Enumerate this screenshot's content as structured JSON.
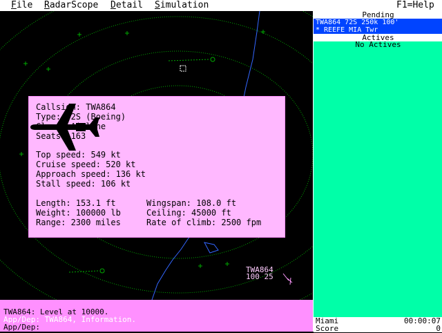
{
  "menu": {
    "file": {
      "hotkey": "F",
      "rest": "ile"
    },
    "radarscope": {
      "hotkey": "R",
      "rest": "adarScope"
    },
    "detail": {
      "hotkey": "D",
      "rest": "etail"
    },
    "simulation": {
      "hotkey": "S",
      "rest": "imulation"
    },
    "help": "F1=Help"
  },
  "panel": {
    "pending_title": "Pending",
    "pending_line1": "TWA864 72S 250k 100'",
    "pending_line2": "* REEFE MIA Twr",
    "actives_title": "Actives",
    "no_actives": "No Actives",
    "airport": "Miami",
    "clock": "00:00:07",
    "score_label": "Score",
    "score_value": "0"
  },
  "aircraft_info": {
    "callsign": "Callsign: TWA864",
    "type": "Type: 72S (Boeing)",
    "class": "Class: Airline",
    "seats": "Seats: 163",
    "top_speed": "Top speed: 549 kt",
    "cruise_speed": "Cruise speed: 520 kt",
    "approach_speed": "Approach speed: 136 kt",
    "stall_speed": "Stall speed: 106 kt",
    "length": "Length: 153.1 ft",
    "wingspan": "Wingspan: 108.0 ft",
    "weight": "Weight: 100000 lb",
    "ceiling": "Ceiling: 45000 ft",
    "range": "Range: 2300 miles",
    "rate_of_climb": "Rate of climb: 2500 fpm"
  },
  "target": {
    "callsign": "TWA864",
    "data": "100 25"
  },
  "messages": {
    "line1": "TWA864: Level at 10000.",
    "line2": "App/Dep: TWA864, Information.",
    "prompt": "App/Dep:"
  },
  "colors": {
    "range_rings": "#00aa00",
    "coastline": "#3366ff",
    "panel_bg": "#00ffa8",
    "message_bg": "#ff90ff",
    "info_bg": "#ffb8ff"
  }
}
